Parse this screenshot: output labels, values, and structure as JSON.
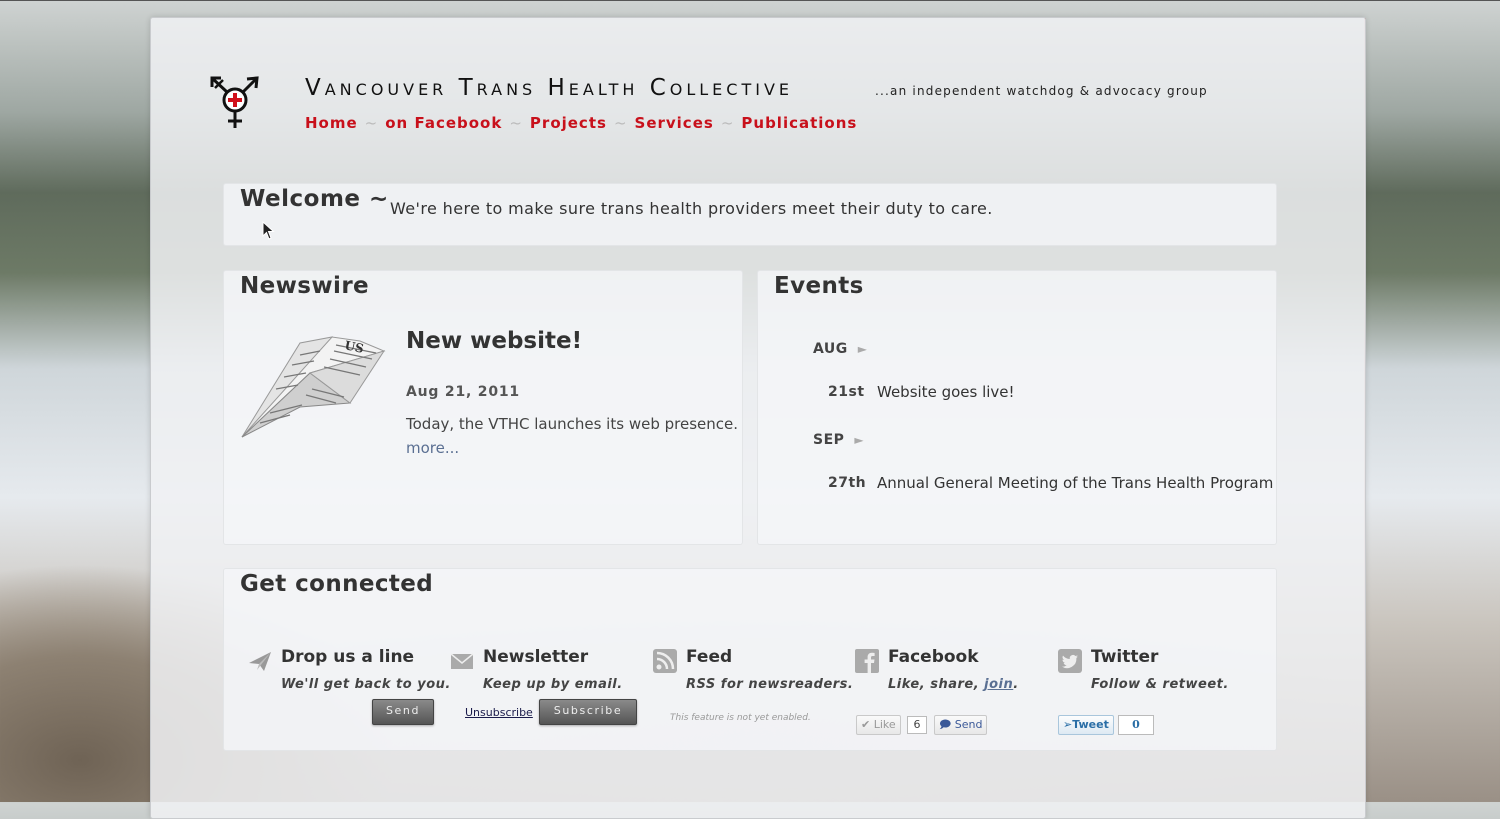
{
  "site": {
    "title_parts": [
      "Vancouver ",
      "Trans ",
      "Health ",
      "Collective"
    ],
    "tagline": "...an independent watchdog & advocacy group"
  },
  "nav": [
    "Home",
    "on Facebook",
    "Projects",
    "Services",
    "Publications"
  ],
  "nav_separator": "~",
  "welcome": {
    "heading": "Welcome ~",
    "text": "We're here to make sure trans health providers meet their duty to care."
  },
  "newswire": {
    "heading": "Newswire",
    "title": "New website!",
    "date": "Aug 21, 2011",
    "body": "Today, the VTHC launches its web presence.",
    "more": "more..."
  },
  "events": {
    "heading": "Events",
    "months": [
      {
        "month": "AUG",
        "day": "21st",
        "text": "Website goes live!"
      },
      {
        "month": "SEP",
        "day": "27th",
        "text": "Annual General Meeting of the Trans Health Program"
      }
    ]
  },
  "connect": {
    "heading": "Get connected",
    "drop": {
      "title": "Drop us a line",
      "sub": "We'll get back to you.",
      "button": "Send"
    },
    "newsletter": {
      "title": "Newsletter",
      "sub": "Keep up by email.",
      "unsubscribe": "Unsubscribe",
      "button": "Subscribe"
    },
    "feed": {
      "title": "Feed",
      "sub": "RSS for newsreaders.",
      "note": "This feature is not yet enabled."
    },
    "facebook": {
      "title": "Facebook",
      "sub_prefix": "Like, share, ",
      "sub_link": "join",
      "sub_suffix": ".",
      "like": "Like",
      "like_count": "6",
      "send": "Send"
    },
    "twitter": {
      "title": "Twitter",
      "sub": "Follow & retweet.",
      "tweet": "Tweet",
      "tweet_count": "0"
    }
  },
  "colors": {
    "nav_red": "#c8101b",
    "link_blue": "#5a6f92"
  }
}
